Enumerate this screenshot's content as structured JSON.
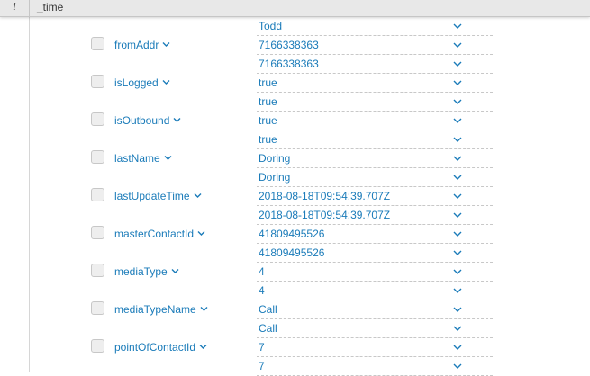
{
  "header": {
    "info_label": "i",
    "time_label": "_time"
  },
  "top_row": {
    "value": "Todd"
  },
  "fields": [
    {
      "name": "fromAddr",
      "values": [
        "7166338363",
        "7166338363"
      ]
    },
    {
      "name": "isLogged",
      "values": [
        "true",
        "true"
      ]
    },
    {
      "name": "isOutbound",
      "values": [
        "true",
        "true"
      ]
    },
    {
      "name": "lastName",
      "values": [
        "Doring",
        "Doring"
      ]
    },
    {
      "name": "lastUpdateTime",
      "values": [
        "2018-08-18T09:54:39.707Z",
        "2018-08-18T09:54:39.707Z"
      ]
    },
    {
      "name": "masterContactId",
      "values": [
        "41809495526",
        "41809495526"
      ]
    },
    {
      "name": "mediaType",
      "values": [
        "4",
        "4"
      ]
    },
    {
      "name": "mediaTypeName",
      "values": [
        "Call",
        "Call"
      ]
    },
    {
      "name": "pointOfContactId",
      "values": [
        "7",
        "7"
      ]
    }
  ],
  "icons": {
    "expand": "chevron-down-icon",
    "select": "checkbox"
  },
  "colors": {
    "link": "#1a7bb9",
    "header_bg": "#e8e8e8",
    "divider": "#c8c8c8"
  }
}
